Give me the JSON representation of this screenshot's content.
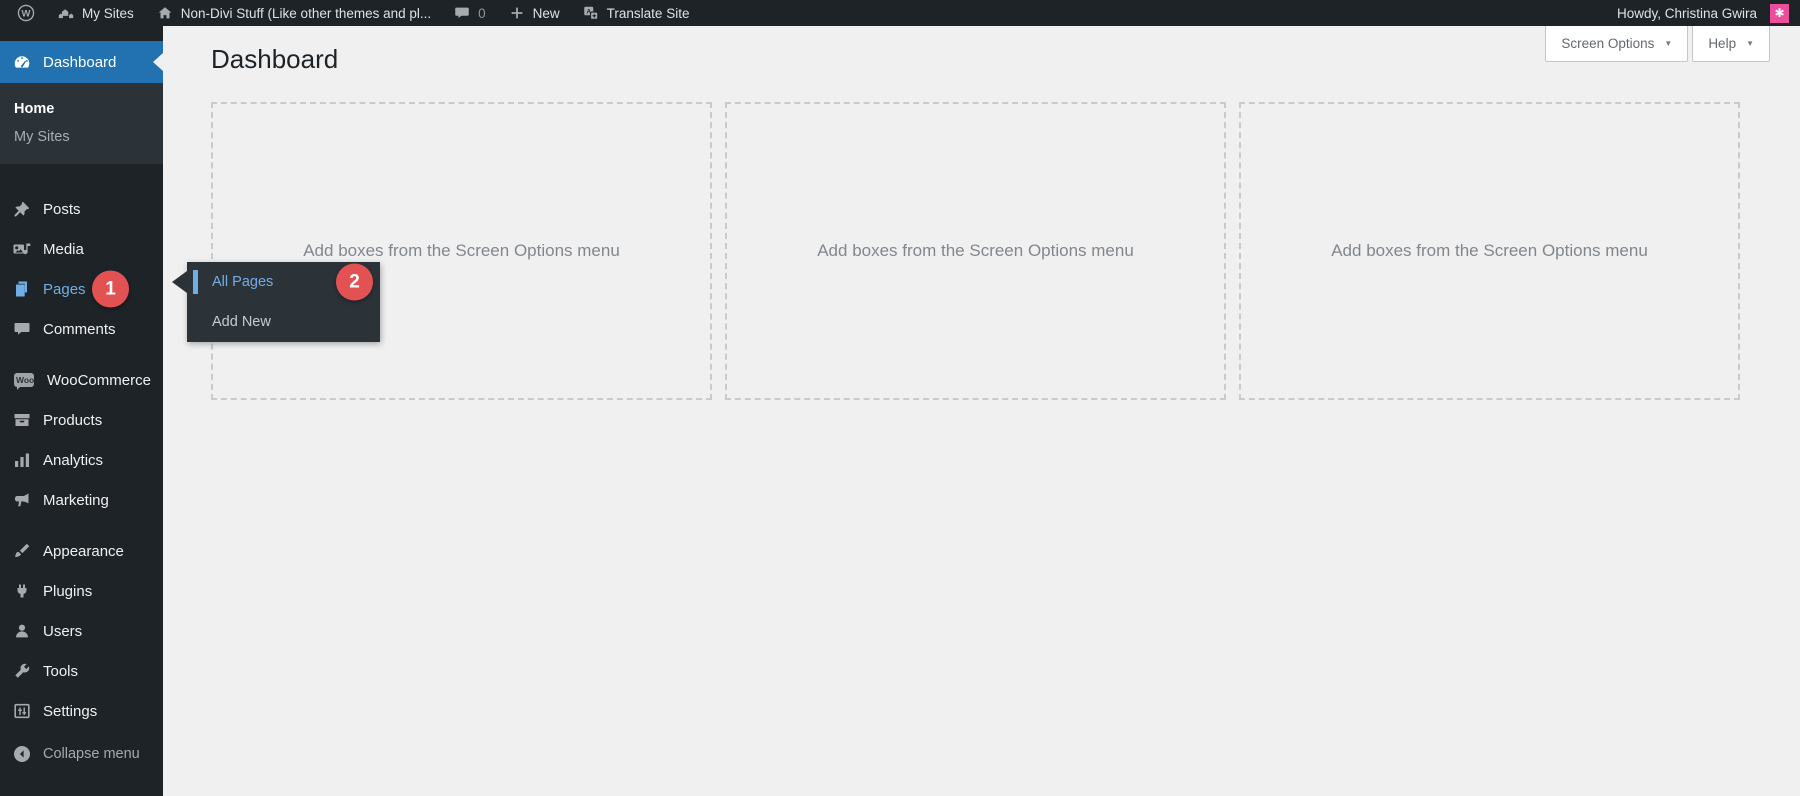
{
  "admin_bar": {
    "my_sites_label": "My Sites",
    "site_name": "Non-Divi Stuff (Like other themes and pl...",
    "comment_count": "0",
    "new_label": "New",
    "translate_label": "Translate Site",
    "howdy_label": "Howdy, Christina Gwira",
    "avatar_glyph": "✱",
    "wp_logo_glyph": "W"
  },
  "sidebar": {
    "dashboard_label": "Dashboard",
    "submenu": [
      {
        "label": "Home"
      },
      {
        "label": "My Sites"
      }
    ],
    "items": [
      {
        "label": "Posts"
      },
      {
        "label": "Media"
      },
      {
        "label": "Pages",
        "badge": "1"
      },
      {
        "label": "Comments"
      },
      {
        "label": "WooCommerce"
      },
      {
        "label": "Products"
      },
      {
        "label": "Analytics"
      },
      {
        "label": "Marketing"
      },
      {
        "label": "Appearance"
      },
      {
        "label": "Plugins"
      },
      {
        "label": "Users"
      },
      {
        "label": "Tools"
      },
      {
        "label": "Settings"
      }
    ],
    "woo_icon_text": "Woo",
    "collapse_label": "Collapse menu"
  },
  "flyout": {
    "items": [
      {
        "label": "All Pages",
        "badge": "2"
      },
      {
        "label": "Add New"
      }
    ]
  },
  "main": {
    "title": "Dashboard",
    "screen_options_label": "Screen Options",
    "help_label": "Help",
    "dropdown_glyph": "▼",
    "placeholder": "Add boxes from the Screen Options menu"
  },
  "colors": {
    "accent_blue": "#2271b1",
    "link_blue": "#72aee6",
    "badge_red": "#e35252",
    "avatar_pink": "#ec4e9b",
    "admin_dark": "#1d2327",
    "submenu_dark": "#2c3338",
    "content_bg": "#f0f0f1"
  }
}
